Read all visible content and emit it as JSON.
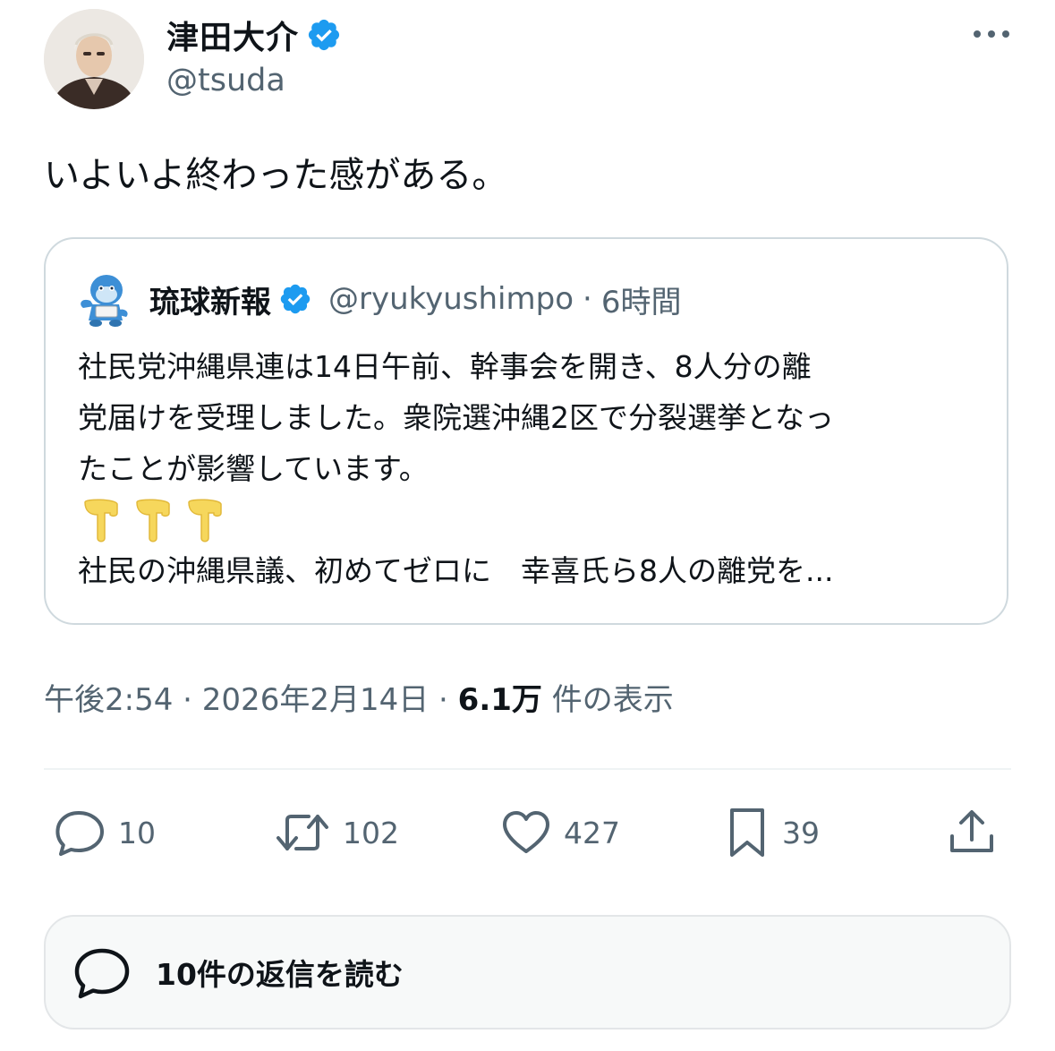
{
  "author": {
    "name": "津田大介",
    "handle": "@tsuda",
    "verified": true,
    "avatar_icon": "user-avatar"
  },
  "more_icon": "more-horizontal-icon",
  "tweet": {
    "text": "いよいよ終わった感がある。"
  },
  "quote": {
    "name": "琉球新報",
    "handle": "@ryukyushimpo",
    "separator": "·",
    "time": "6時間",
    "verified": true,
    "lines": [
      "社民党沖縄県連は14日午前、幹事会を開き、8人分の離",
      "党届けを受理しました。衆院選沖縄2区で分裂選挙となっ",
      "たことが影響しています。"
    ],
    "emoji": [
      "👇",
      "👇",
      "👇"
    ],
    "link_title": "社民の沖縄県議、初めてゼロに　幸喜氏ら8人の離党を..."
  },
  "meta": {
    "time": "午後2:54",
    "separator": "·",
    "date": "2026年2月14日",
    "views_count": "6.1万",
    "views_label": "件の表示"
  },
  "actions": {
    "reply_count": "10",
    "retweet_count": "102",
    "like_count": "427",
    "bookmark_count": "39"
  },
  "replies_button": {
    "label": "10件の返信を読む"
  },
  "colors": {
    "text_primary": "#0f1419",
    "text_secondary": "#536471",
    "verified_blue": "#1d9bf0",
    "border": "#cfd9de",
    "divider": "#eff3f4"
  }
}
